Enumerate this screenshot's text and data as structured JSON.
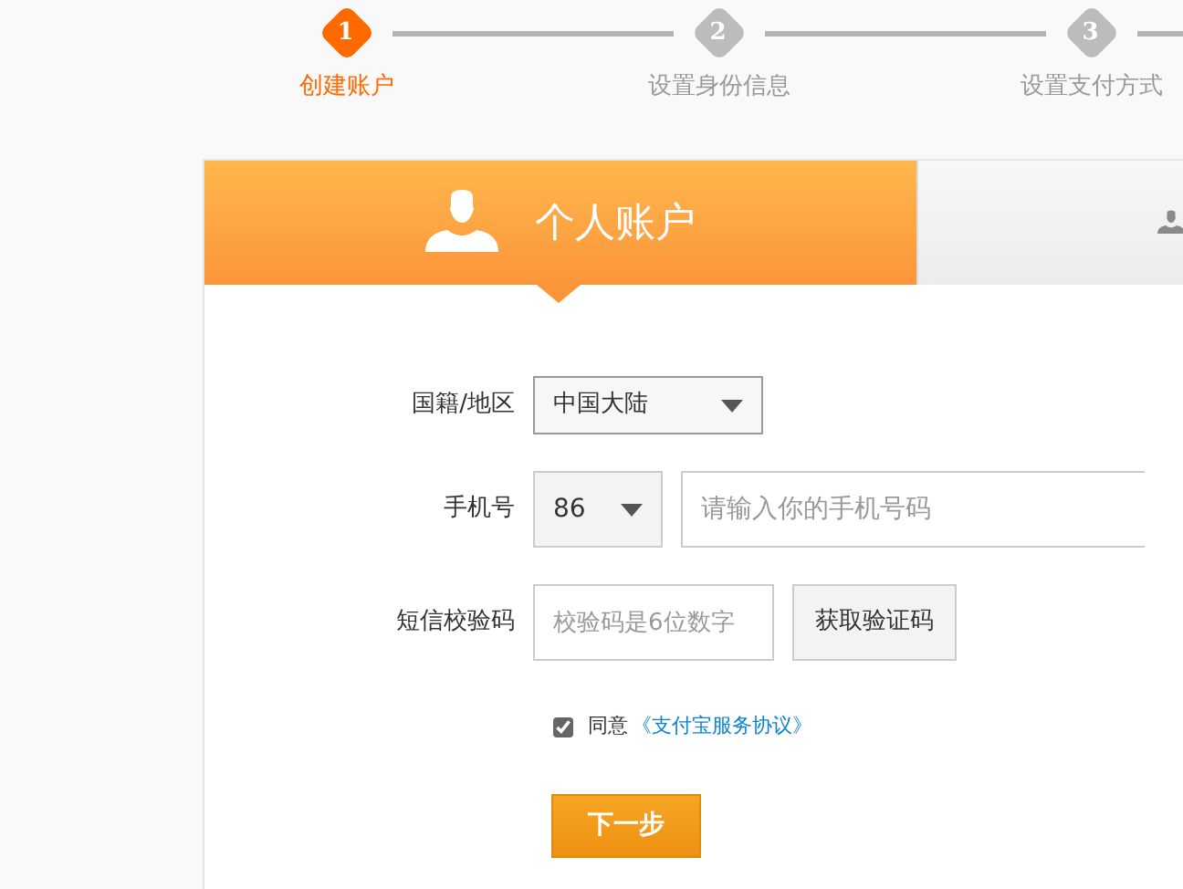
{
  "steps": [
    {
      "number": "1",
      "label": "创建账户",
      "selected": true
    },
    {
      "number": "2",
      "label": "设置身份信息",
      "selected": false
    },
    {
      "number": "3",
      "label": "设置支付方式",
      "selected": false
    }
  ],
  "tabs": [
    {
      "label": "个人账户",
      "selected": true
    },
    {
      "selected": false
    }
  ],
  "form": {
    "region": {
      "label": "国籍/地区",
      "value": "中国大陆"
    },
    "phone": {
      "label": "手机号",
      "code": "86",
      "placeholder": "请输入你的手机号码"
    },
    "sms": {
      "label": "短信校验码",
      "placeholder": "校验码是6位数字",
      "button": "获取验证码"
    },
    "agree": {
      "checked": true,
      "text": "同意",
      "link": "《支付宝服务协议》"
    },
    "submit": "下一步"
  }
}
